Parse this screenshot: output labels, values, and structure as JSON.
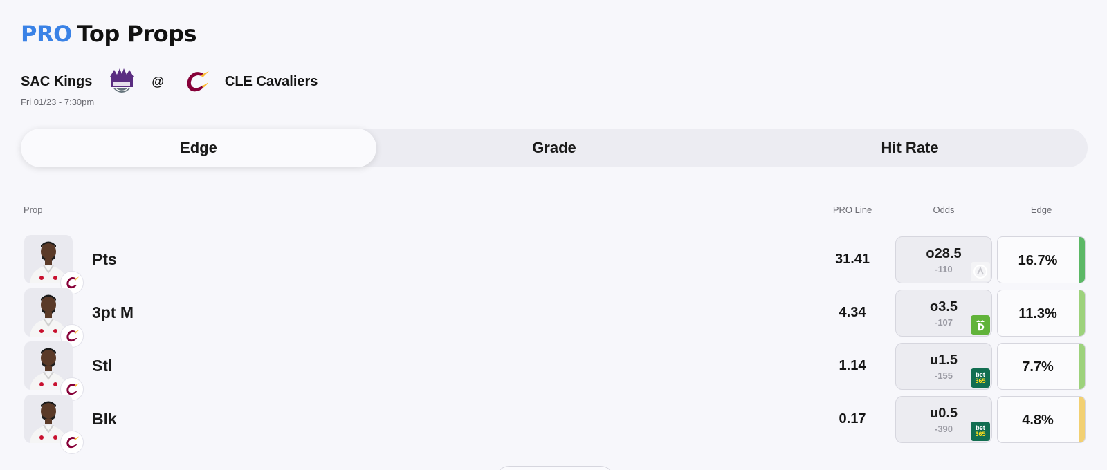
{
  "header": {
    "pro_label": "PRO",
    "title": "Top Props"
  },
  "matchup": {
    "away_team": "SAC Kings",
    "away_logo_icon": "sacramento-kings-logo-icon",
    "at": "@",
    "home_logo_icon": "cleveland-cavaliers-logo-icon",
    "home_team": "CLE Cavaliers",
    "datetime": "Fri 01/23 - 7:30pm"
  },
  "tabs": [
    {
      "label": "Edge",
      "active": true
    },
    {
      "label": "Grade",
      "active": false
    },
    {
      "label": "Hit Rate",
      "active": false
    }
  ],
  "columns": {
    "prop": "Prop",
    "pro_line": "PRO Line",
    "odds": "Odds",
    "edge": "Edge"
  },
  "colors": {
    "accent_blue": "#3a82e6",
    "edge_high": "#5cb866",
    "edge_mid": "#9dd27c",
    "edge_low": "#f2d072"
  },
  "props": [
    {
      "prop": "Pts",
      "pro_line": "31.41",
      "odds_line": "o28.5",
      "odds_price": "-110",
      "book": "fanatics-icon",
      "edge": "16.7%",
      "edge_color": "#5cb866"
    },
    {
      "prop": "3pt M",
      "pro_line": "4.34",
      "odds_line": "o3.5",
      "odds_price": "-107",
      "book": "draftkings-icon",
      "edge": "11.3%",
      "edge_color": "#9dd27c"
    },
    {
      "prop": "Stl",
      "pro_line": "1.14",
      "odds_line": "u1.5",
      "odds_price": "-155",
      "book": "bet365-icon",
      "book_text_1": "bet",
      "book_text_2": "365",
      "edge": "7.7%",
      "edge_color": "#9dd27c"
    },
    {
      "prop": "Blk",
      "pro_line": "0.17",
      "odds_line": "u0.5",
      "odds_price": "-390",
      "book": "bet365-icon",
      "book_text_1": "bet",
      "book_text_2": "365",
      "edge": "4.8%",
      "edge_color": "#f2d072"
    }
  ]
}
